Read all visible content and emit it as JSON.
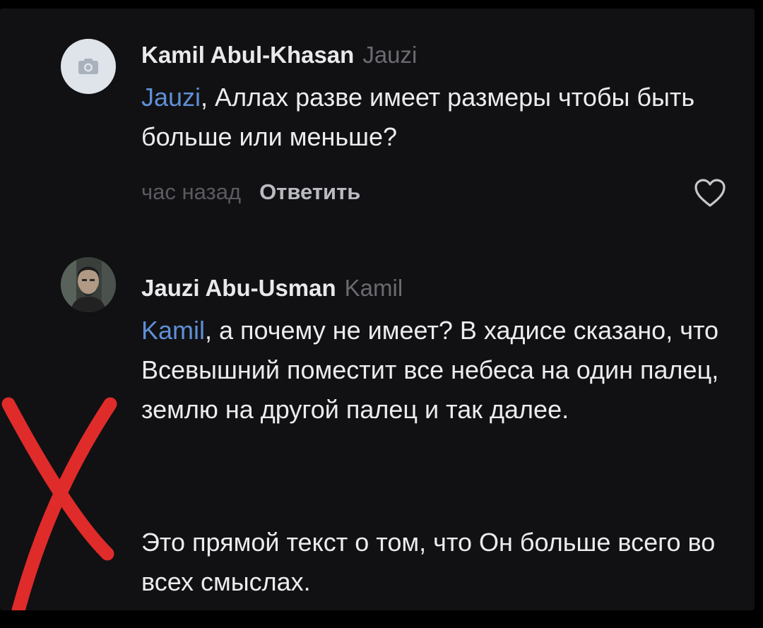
{
  "colors": {
    "background": "#111113",
    "author": "#e9e9ec",
    "mention": "#5f8fd6",
    "muted": "#5a5b60",
    "mark": "#e02b2b"
  },
  "comments": [
    {
      "author": "Kamil Abul-Khasan",
      "reply_to": "Jauzi",
      "mention": "Jauzi",
      "text": ", Аллах разве имеет размеры чтобы быть больше или меньше?",
      "time": "час назад",
      "reply_label": "Ответить",
      "avatar_icon": "camera-icon",
      "like_icon": "heart-outline-icon"
    },
    {
      "author": "Jauzi Abu-Usman",
      "reply_to": "Kamil",
      "mention": "Kamil",
      "text": ", а почему не имеет? В хадисе сказано, что Всевышний поместит все небеса на один палец, землю на другой палец и так далее.",
      "text2": "Это прямой текст о том, что Он больше всего во всех смыслах.",
      "avatar_icon": "user-photo"
    }
  ],
  "annotation": {
    "icon": "red-x-mark"
  }
}
